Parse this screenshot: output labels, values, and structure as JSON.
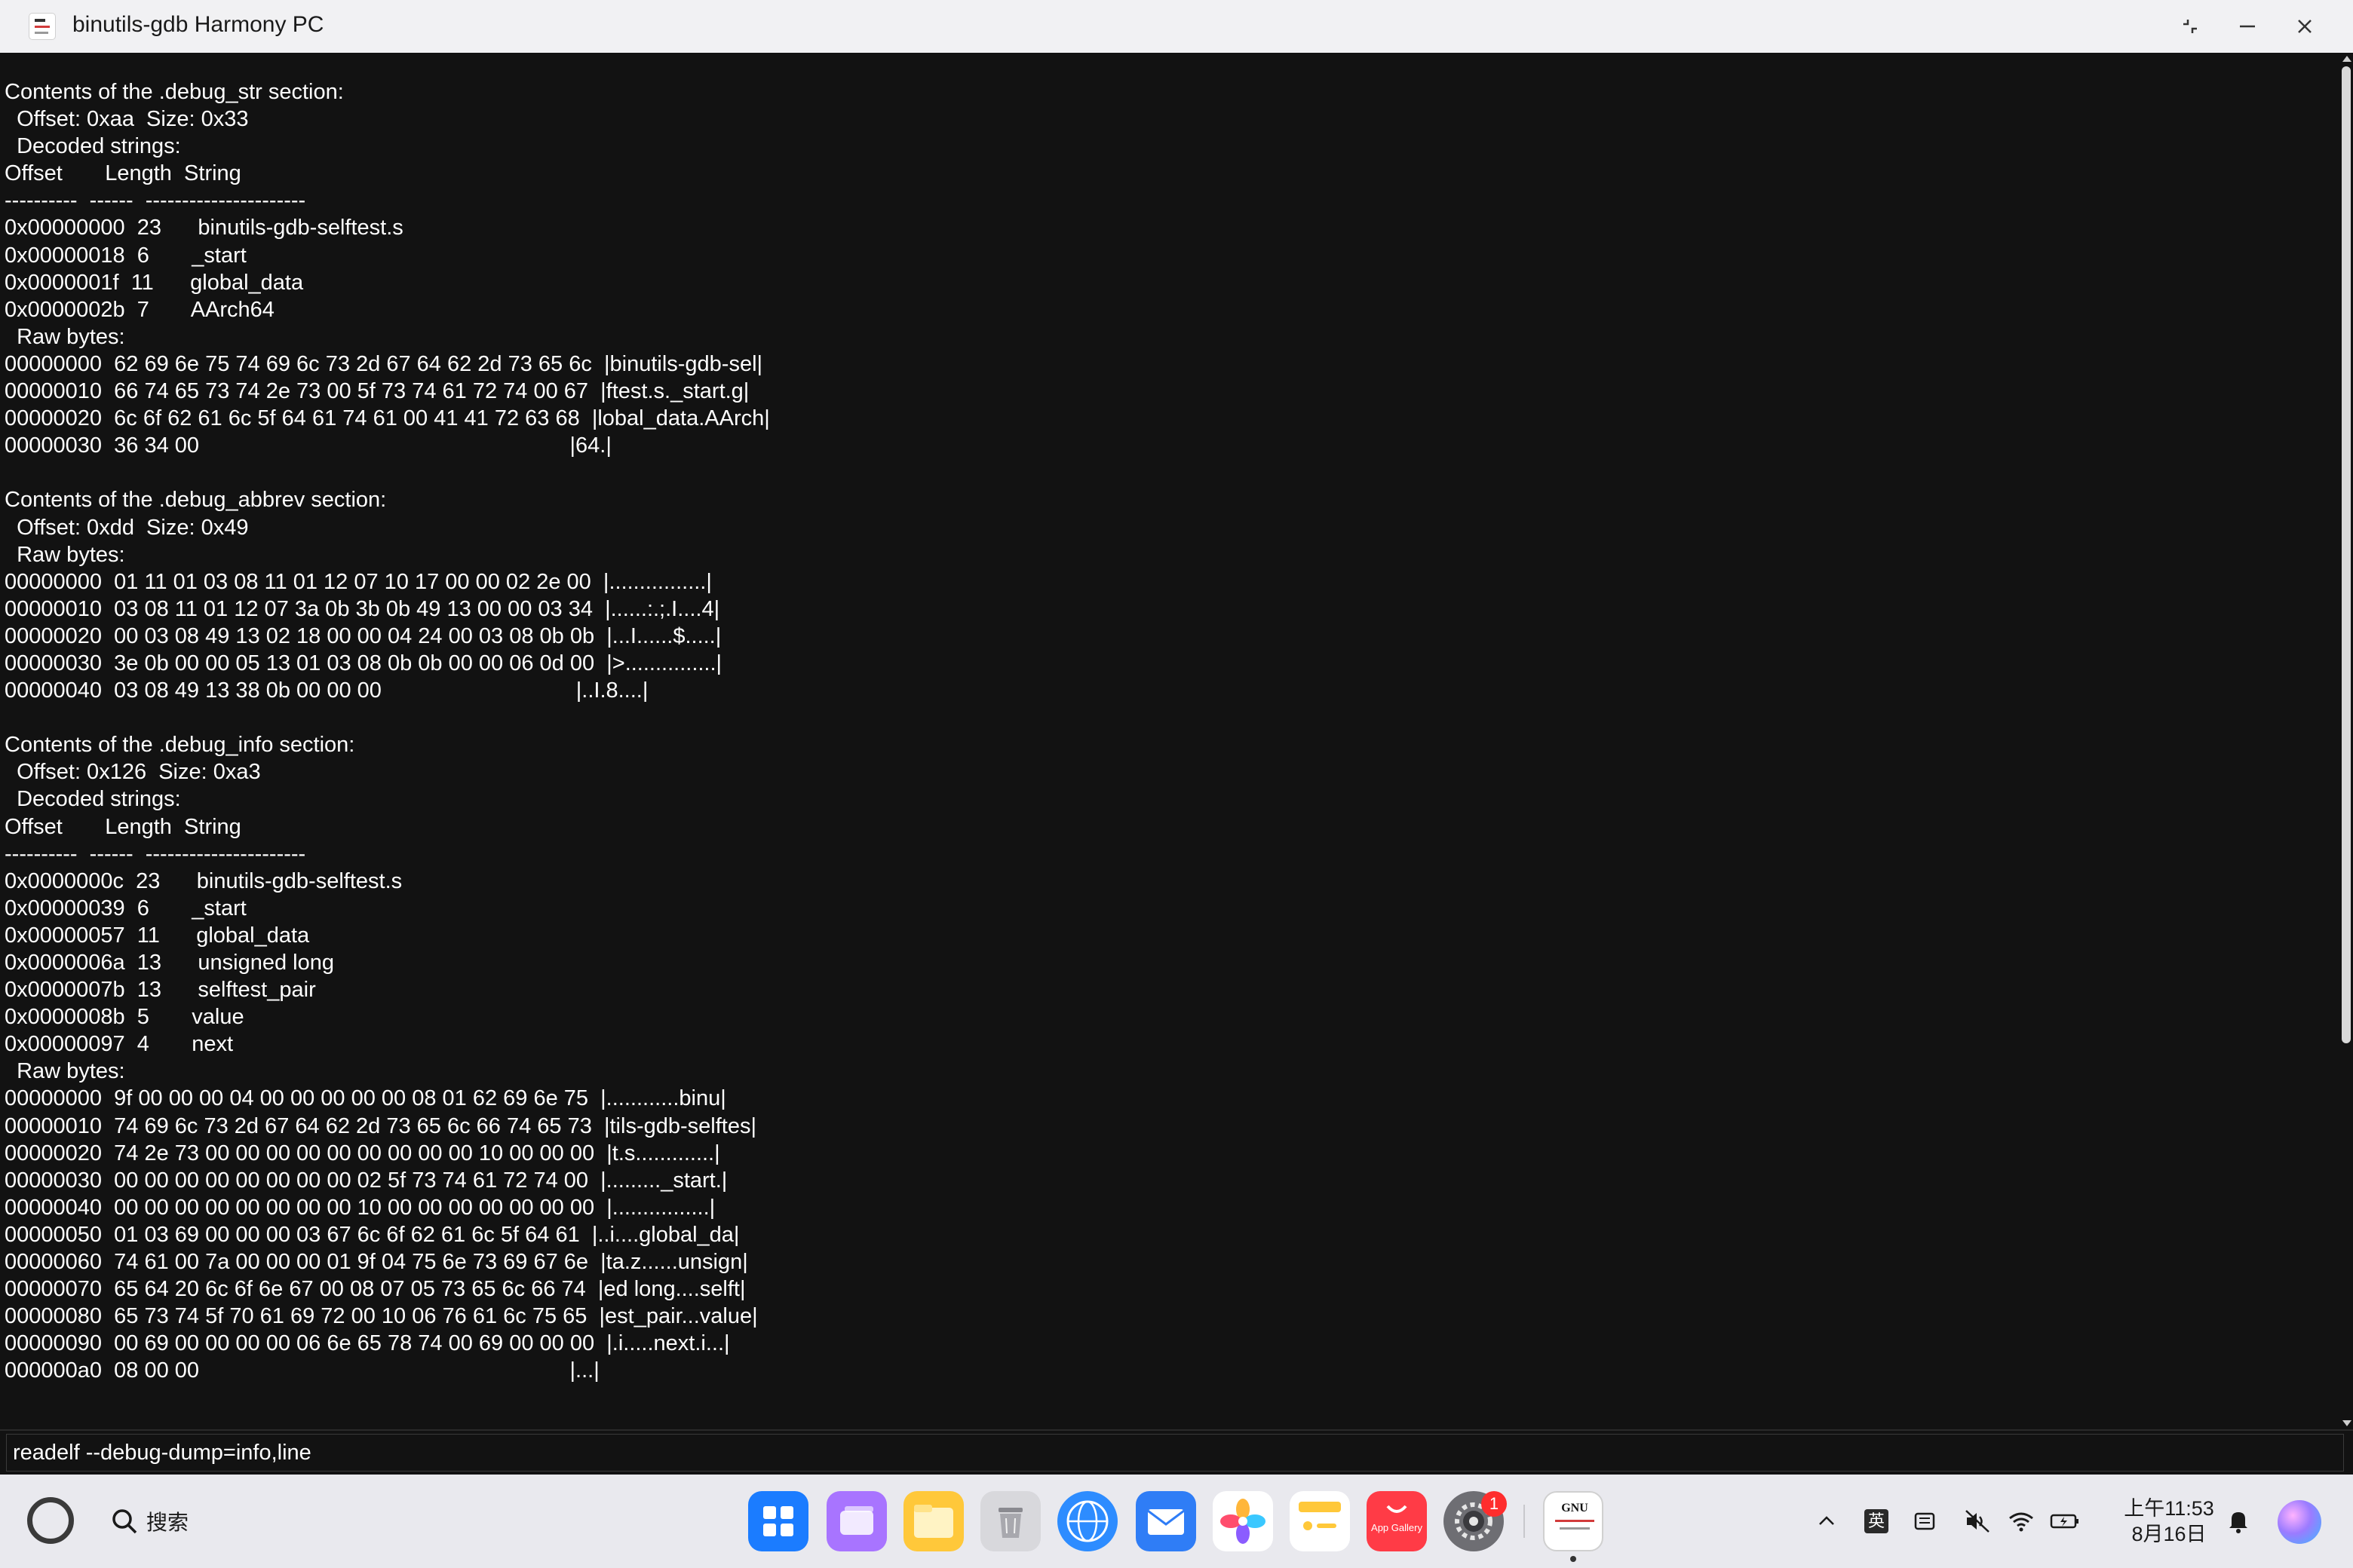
{
  "window": {
    "title": "binutils-gdb Harmony PC"
  },
  "terminal": {
    "lines": [
      "Contents of the .debug_str section:",
      "  Offset: 0xaa  Size: 0x33",
      "  Decoded strings:",
      "Offset       Length  String",
      "----------  ------  ----------------------",
      "0x00000000  23      binutils-gdb-selftest.s",
      "0x00000018  6       _start",
      "0x0000001f  11      global_data",
      "0x0000002b  7       AArch64",
      "  Raw bytes:",
      "00000000  62 69 6e 75 74 69 6c 73 2d 67 64 62 2d 73 65 6c  |binutils-gdb-sel|",
      "00000010  66 74 65 73 74 2e 73 00 5f 73 74 61 72 74 00 67  |ftest.s._start.g|",
      "00000020  6c 6f 62 61 6c 5f 64 61 74 61 00 41 41 72 63 68  |lobal_data.AArch|",
      "00000030  36 34 00                                                             |64.|",
      "",
      "Contents of the .debug_abbrev section:",
      "  Offset: 0xdd  Size: 0x49",
      "  Raw bytes:",
      "00000000  01 11 01 03 08 11 01 12 07 10 17 00 00 02 2e 00  |................|",
      "00000010  03 08 11 01 12 07 3a 0b 3b 0b 49 13 00 00 03 34  |......:.;.I....4|",
      "00000020  00 03 08 49 13 02 18 00 00 04 24 00 03 08 0b 0b  |...I......$.....|",
      "00000030  3e 0b 00 00 05 13 01 03 08 0b 0b 00 00 06 0d 00  |>...............|",
      "00000040  03 08 49 13 38 0b 00 00 00                                |..I.8....|",
      "",
      "Contents of the .debug_info section:",
      "  Offset: 0x126  Size: 0xa3",
      "  Decoded strings:",
      "Offset       Length  String",
      "----------  ------  ----------------------",
      "0x0000000c  23      binutils-gdb-selftest.s",
      "0x00000039  6       _start",
      "0x00000057  11      global_data",
      "0x0000006a  13      unsigned long",
      "0x0000007b  13      selftest_pair",
      "0x0000008b  5       value",
      "0x00000097  4       next",
      "  Raw bytes:",
      "00000000  9f 00 00 00 04 00 00 00 00 00 08 01 62 69 6e 75  |............binu|",
      "00000010  74 69 6c 73 2d 67 64 62 2d 73 65 6c 66 74 65 73  |tils-gdb-selftes|",
      "00000020  74 2e 73 00 00 00 00 00 00 00 00 00 10 00 00 00  |t.s.............|",
      "00000030  00 00 00 00 00 00 00 00 02 5f 73 74 61 72 74 00  |........._start.|",
      "00000040  00 00 00 00 00 00 00 00 10 00 00 00 00 00 00 00  |................|",
      "00000050  01 03 69 00 00 00 03 67 6c 6f 62 61 6c 5f 64 61  |..i....global_da|",
      "00000060  74 61 00 7a 00 00 00 01 9f 04 75 6e 73 69 67 6e  |ta.z......unsign|",
      "00000070  65 64 20 6c 6f 6e 67 00 08 07 05 73 65 6c 66 74  |ed long....selft|",
      "00000080  65 73 74 5f 70 61 69 72 00 10 06 76 61 6c 75 65  |est_pair...value|",
      "00000090  00 69 00 00 00 00 06 6e 65 78 74 00 69 00 00 00  |.i.....next.i...|",
      "000000a0  08 00 00                                                             |...|"
    ],
    "command": "readelf --debug-dump=info,line"
  },
  "taskbar": {
    "search_label": "搜索",
    "gallery_label": "App Gallery",
    "gnu_label": "GNU",
    "settings_badge": "1",
    "ime_label": "英",
    "clock_time": "上午11:53",
    "clock_date": "8月16日"
  },
  "colors": {
    "terminal_bg": "#121212",
    "terminal_fg": "#ffffff",
    "titlebar_bg": "#f1f1f3",
    "taskbar_bg": "#e9e9ee",
    "badge_red": "#ff2d2d"
  },
  "icons": {
    "title": [
      "app-icon",
      "restore-icon",
      "minimize-icon",
      "close-icon"
    ],
    "taskbar": [
      "start-icon",
      "search-icon",
      "launcher-icon",
      "multitask-icon",
      "files-icon",
      "trash-icon",
      "browser-icon",
      "mail-icon",
      "photos-icon",
      "notes-icon",
      "app-gallery-icon",
      "settings-icon",
      "gnu-app-icon"
    ],
    "tray": [
      "chevron-up-icon",
      "ime-icon",
      "keyboard-icon",
      "volume-muted-icon",
      "wifi-icon",
      "battery-icon",
      "bell-icon",
      "assistant-icon"
    ]
  }
}
